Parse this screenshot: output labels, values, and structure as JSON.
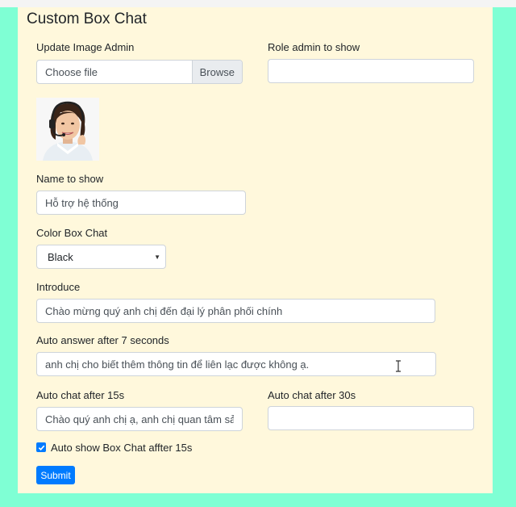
{
  "form": {
    "title": "Custom Box Chat",
    "update_image": {
      "label": "Update Image Admin",
      "file_placeholder": "Choose file",
      "browse_label": "Browse"
    },
    "role_admin": {
      "label": "Role admin to show",
      "value": ""
    },
    "name_to_show": {
      "label": "Name to show",
      "value": "Hỗ trợ hệ thống"
    },
    "color_box_chat": {
      "label": "Color Box Chat",
      "selected": "Black"
    },
    "introduce": {
      "label": "Introduce",
      "value": "Chào mừng quý anh chị đến đại lý phân phối chính"
    },
    "auto_answer": {
      "label": "Auto answer after 7 seconds",
      "value": "anh chị cho biết thêm thông tin để liên lạc được không ạ."
    },
    "auto_chat_15": {
      "label": "Auto chat after 15s",
      "value": "Chào quý anh chị ạ, anh chị quan tâm sản p"
    },
    "auto_chat_30": {
      "label": "Auto chat after 30s",
      "value": ""
    },
    "auto_show": {
      "label": "Auto show Box Chat affter 15s",
      "checked": true
    },
    "submit_label": "Submit"
  },
  "icons": {
    "avatar": "support-agent-avatar",
    "select_caret": "caret-down-icon",
    "checkbox": "checkmark-icon",
    "cursor": "text-cursor-icon"
  },
  "colors": {
    "background": "#7fffd4",
    "panel": "#fff8dc",
    "primary": "#007bff"
  }
}
